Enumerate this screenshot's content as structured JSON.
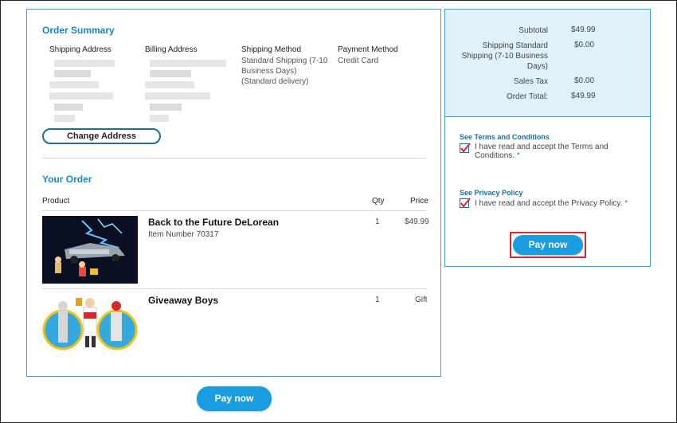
{
  "order_summary": {
    "title": "Order Summary",
    "shipping_address_label": "Shipping Address",
    "billing_address_label": "Billing Address",
    "shipping_method_label": "Shipping Method",
    "shipping_method_value": "Standard Shipping (7-10 Business Days) (Standard delivery)",
    "payment_method_label": "Payment Method",
    "payment_method_value": "Credit Card",
    "change_address_label": "Change Address"
  },
  "your_order": {
    "title": "Your Order",
    "col_product": "Product",
    "col_qty": "Qty",
    "col_price": "Price",
    "items": [
      {
        "name": "Back to the Future DeLorean",
        "item_number": "Item Number 70317",
        "qty": "1",
        "price": "$49.99"
      },
      {
        "name": "Giveaway Boys",
        "item_number": "",
        "qty": "1",
        "price": "Gift"
      }
    ]
  },
  "totals": {
    "subtotal_label": "Subtotal",
    "subtotal_value": "$49.99",
    "shipping_label": "Shipping Standard Shipping (7-10 Business Days)",
    "shipping_value": "$0.00",
    "tax_label": "Sales Tax",
    "tax_value": "$0.00",
    "total_label": "Order Total:",
    "total_value": "$49.99"
  },
  "terms": {
    "terms_link": "See Terms and Conditions",
    "terms_text": "I have read and accept the Terms and Conditions.",
    "privacy_link": "See Privacy Policy",
    "privacy_text": "I have read and accept the Privacy Policy.",
    "required_mark": "*"
  },
  "pay_now_label": "Pay now",
  "colors": {
    "accent": "#1a9de0",
    "highlight": "#d9262f",
    "panel_bg": "#dff2fb"
  }
}
